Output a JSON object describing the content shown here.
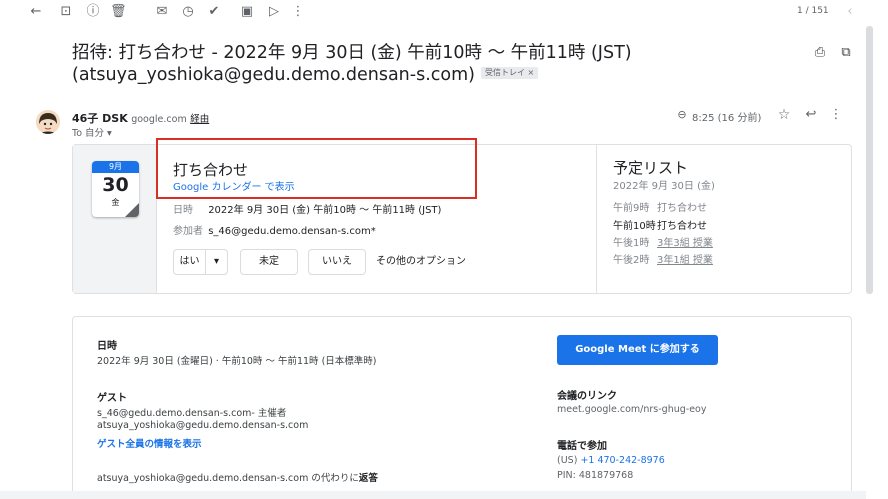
{
  "toolbar": {
    "back_icon": "←",
    "archive_icon": "⊡",
    "report_icon": "ⓘ",
    "delete_icon": "🗑",
    "mark_unread_icon": "✉",
    "snooze_icon": "◷",
    "add_task_icon": "✔",
    "move_icon": "▣",
    "label_icon": "▷",
    "more_icon": "⋮",
    "page_count": "1 / 151",
    "prev_icon": "‹"
  },
  "subject": {
    "line1": "招待: 打ち合わせ - 2022年 9月 30日 (金) 午前10時 〜 午前11時 (JST)",
    "line2": "(atsuya_yoshioka@gedu.demo.densan-s.com)",
    "label": "受信トレイ ×",
    "print_icon": "⎙",
    "popout_icon": "⧉"
  },
  "message": {
    "sender_name": "46子 DSK",
    "sender_domain": "google.com",
    "via": "経由",
    "to": "To 自分 ▾",
    "time": "8:25 (16 分前)",
    "attach_icon": "⊖",
    "star_icon": "☆",
    "reply_icon": "↩",
    "more_icon": "⋮"
  },
  "invite": {
    "cal_month": "9月",
    "cal_day": "30",
    "cal_weekday": "金",
    "title": "打ち合わせ",
    "view_link": "Google カレンダー で表示",
    "when_label": "日時",
    "when_value": "2022年 9月 30日 (金) 午前10時 〜 午前11時 (JST)",
    "guests_label": "参加者",
    "guests_value": "s_46@gedu.demo.densan-s.com*",
    "rsvp_yes": "はい",
    "rsvp_dropdown": "▾",
    "rsvp_maybe": "未定",
    "rsvp_no": "いいえ",
    "more_options": "その他のオプション"
  },
  "agenda": {
    "title": "予定リスト",
    "date": "2022年 9月 30日 (金)",
    "items": [
      {
        "time": "午前9時",
        "title": "打ち合わせ"
      },
      {
        "time": "午前10時",
        "title": "打ち合わせ"
      },
      {
        "time": "午後1時",
        "title": "3年3組 授業"
      },
      {
        "time": "午後2時",
        "title": "3年1組 授業"
      }
    ]
  },
  "details": {
    "when_heading": "日時",
    "when_value": "2022年 9月 30日 (金曜日) · 午前10時 〜 午前11時 (日本標準時)",
    "guests_heading": "ゲスト",
    "guest1": "s_46@gedu.demo.densan-s.com- 主催者",
    "guest2": "atsuya_yoshioka@gedu.demo.densan-s.com",
    "show_all_guests": "ゲスト全員の情報を表示",
    "reply_on_behalf": "atsuya_yoshioka@gedu.demo.densan-s.com の代わりに",
    "reply_bold": "返答",
    "meet_button": "Google Meet に参加する",
    "meet_link_heading": "会議のリンク",
    "meet_link": "meet.google.com/nrs-ghug-eoy",
    "phone_heading": "電話で参加",
    "phone_prefix": "(US)",
    "phone_number": "+1 470-242-8976",
    "pin": "PIN: 481879768"
  }
}
